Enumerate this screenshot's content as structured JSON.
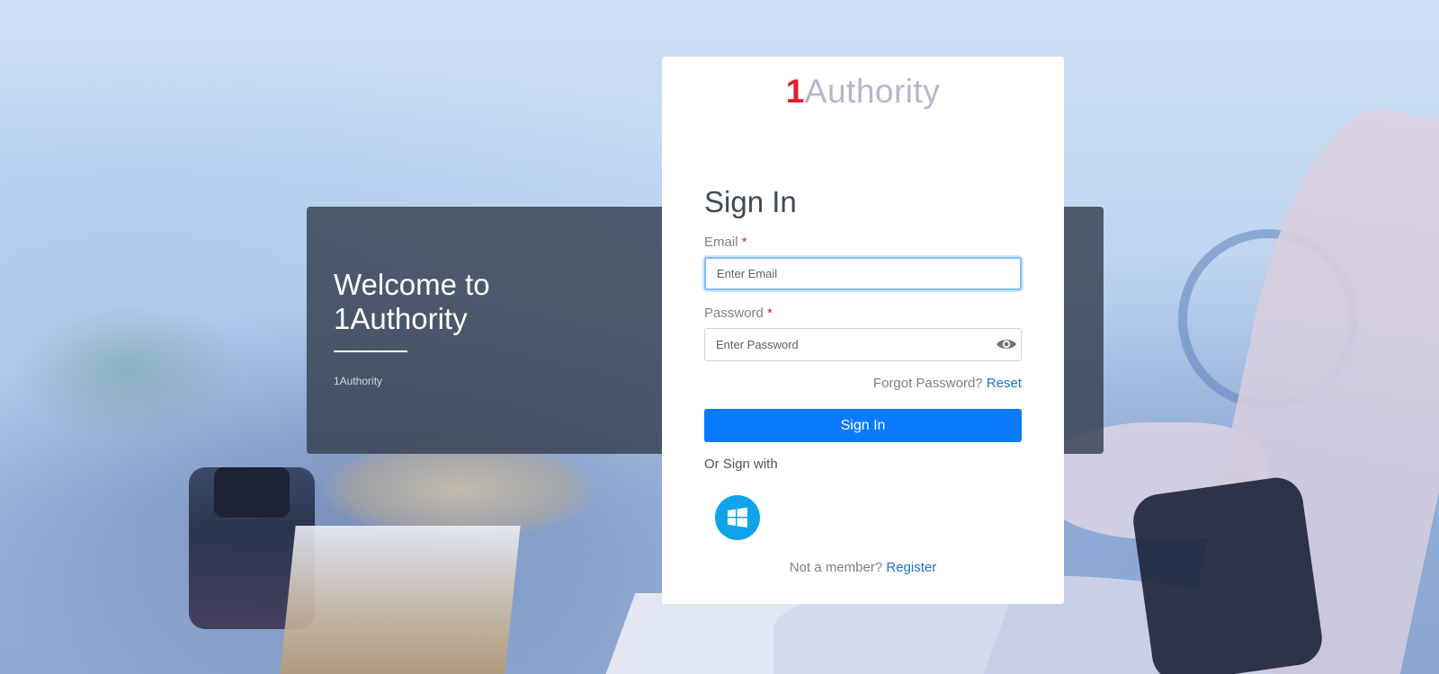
{
  "background": {
    "accent": "#0a7bff"
  },
  "welcome": {
    "title": "Welcome to 1Authority",
    "subtitle": "1Authority"
  },
  "card": {
    "logo_one": "1",
    "logo_rest": "Authority",
    "heading": "Sign In",
    "email_label": "Email",
    "email_required": "*",
    "email_placeholder": "Enter Email",
    "email_value": "",
    "password_label": "Password",
    "password_required": "*",
    "password_placeholder": "Enter Password",
    "password_value": "",
    "password_toggle_icon": "eye-icon",
    "forgot_text": "Forgot Password?",
    "reset_link": "Reset",
    "signin_button": "Sign In",
    "or_sign_with": "Or Sign with",
    "microsoft_icon": "windows-logo-icon",
    "not_member_text": "Not a member?",
    "register_link": "Register"
  },
  "colors": {
    "primary": "#0a7bff",
    "link": "#1d6fd6",
    "required": "#e0202a",
    "logo_red": "#e0202a",
    "logo_gray": "#b3b6cc",
    "microsoft_blue": "#0fa3e9",
    "panel": "#343e4e"
  }
}
